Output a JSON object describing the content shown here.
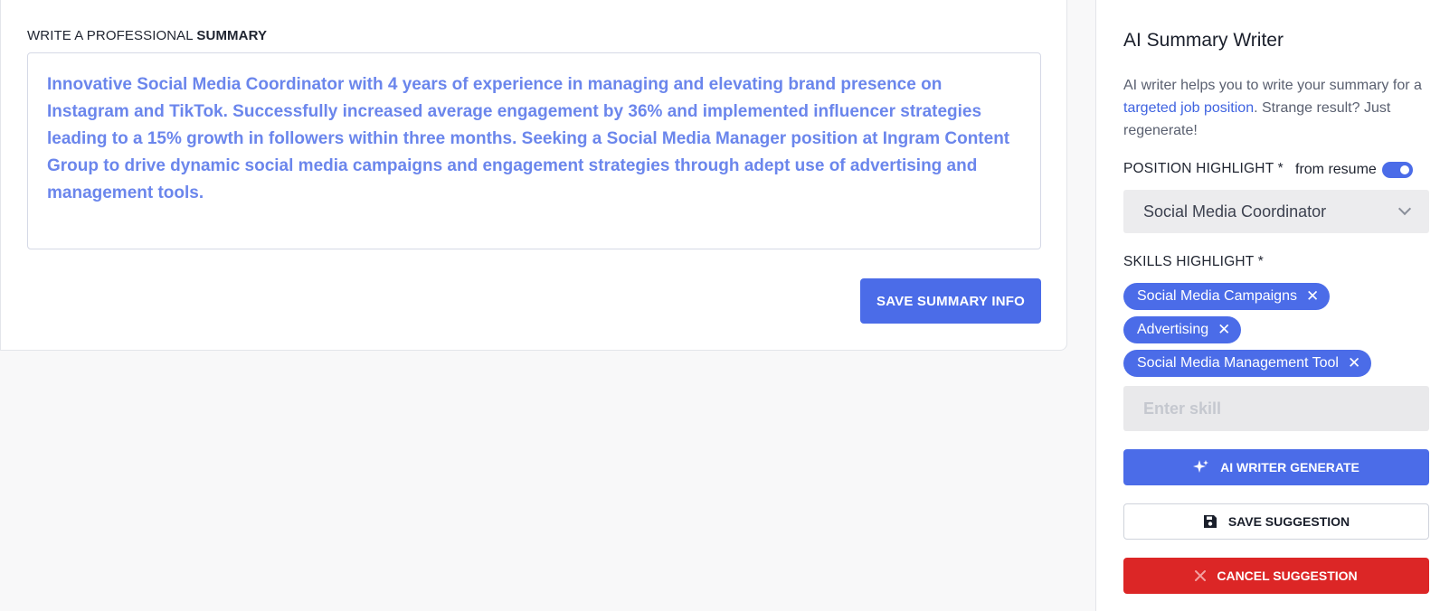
{
  "summary_section": {
    "label_prefix": "WRITE A PROFESSIONAL ",
    "label_bold": "SUMMARY",
    "summary_text": "Innovative Social Media Coordinator with 4 years of experience in managing and elevating brand presence on Instagram and TikTok. Successfully increased average engagement by 36% and implemented influencer strategies leading to a 15% growth in followers within three months. Seeking a Social Media Manager position at Ingram Content Group to drive dynamic social media campaigns and engagement strategies through adept use of advertising and management tools.",
    "save_label": "SAVE SUMMARY INFO"
  },
  "ai_panel": {
    "title": "AI Summary Writer",
    "desc_prefix": "AI writer helps you to write your summary for a ",
    "desc_link": "targeted job position",
    "desc_suffix": ". Strange result? Just regenerate!",
    "position_label": "POSITION HIGHLIGHT *",
    "from_resume_label": "from resume",
    "from_resume_enabled": true,
    "position_value": "Social Media Coordinator",
    "skills_label": "SKILLS HIGHLIGHT *",
    "skills": [
      "Social Media Campaigns",
      "Advertising",
      "Social Media Management Tool"
    ],
    "chip_remove_glyph": "✕",
    "skill_placeholder": "Enter skill",
    "generate_label": "AI WRITER GENERATE",
    "save_suggestion_label": "SAVE SUGGESTION",
    "cancel_suggestion_label": "CANCEL SUGGESTION"
  },
  "colors": {
    "accent": "#4b6ce8",
    "danger": "#dc2626",
    "summary_text": "#6b86ec"
  },
  "icons": {
    "generate": "sparkle-icon",
    "save": "floppy-disk-icon",
    "cancel": "close-icon",
    "select": "chevron-down-icon"
  }
}
